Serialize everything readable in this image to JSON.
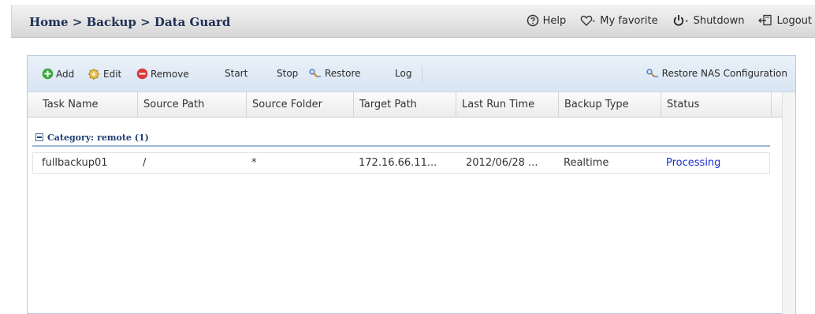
{
  "header": {
    "breadcrumb": "Home > Backup > Data Guard",
    "nav": [
      {
        "label": "Help",
        "icon": "help-circle-icon"
      },
      {
        "label": "My favorite",
        "icon": "heart-icon"
      },
      {
        "label": "Shutdown",
        "icon": "power-icon"
      },
      {
        "label": "Logout",
        "icon": "logout-icon"
      }
    ]
  },
  "toolbar": {
    "add": "Add",
    "edit": "Edit",
    "remove": "Remove",
    "start": "Start",
    "stop": "Stop",
    "restore": "Restore",
    "log": "Log",
    "restore_nas": "Restore NAS Configuration"
  },
  "table": {
    "columns": [
      "Task Name",
      "Source Path",
      "Source Folder",
      "Target Path",
      "Last Run Time",
      "Backup Type",
      "Status"
    ],
    "group_label": "Category: remote (1)",
    "rows": [
      {
        "task_name": "fullbackup01",
        "source_path": "/",
        "source_folder": "*",
        "target_path": "172.16.66.11...",
        "last_run_time": "2012/06/28 ...",
        "backup_type": "Realtime",
        "status": "Processing"
      }
    ]
  },
  "colors": {
    "status_processing": "#1a2fd0",
    "breadcrumb": "#1d2f55",
    "add_icon": "#3aa83a",
    "remove_icon": "#d93a3a"
  }
}
